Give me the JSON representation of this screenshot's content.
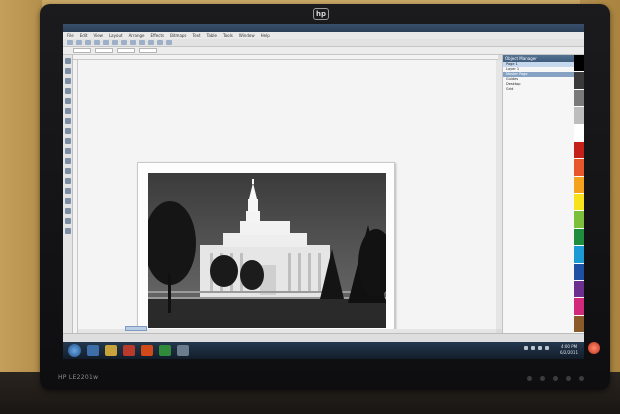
{
  "monitor": {
    "brand_logo": "hp",
    "model_label": "HP LE2201w"
  },
  "app": {
    "title": "",
    "menu": [
      "File",
      "Edit",
      "View",
      "Layout",
      "Arrange",
      "Effects",
      "Bitmaps",
      "Text",
      "Table",
      "Tools",
      "Window",
      "Help"
    ],
    "docker_title": "Object Manager",
    "docker_rows": [
      "Page 1",
      "Layer 1",
      "Master Page",
      "Guides",
      "Desktop",
      "Grid"
    ],
    "status_text": ""
  },
  "taskbar": {
    "clock_time": "4:00 PM",
    "clock_date": "6/2/2011"
  },
  "colors": {
    "wall": "#c9a765",
    "bezel": "#141416",
    "taskbar": "#1b2a3b",
    "docker_header": "#4a6787"
  },
  "palette_colors": [
    "#000000",
    "#3a3a3a",
    "#7a7a7a",
    "#bdbdbd",
    "#ffffff",
    "#c4211b",
    "#e8572b",
    "#f4a21e",
    "#f7e21b",
    "#7bbf3a",
    "#1e8e3e",
    "#1b9ad6",
    "#1d4fa3",
    "#6b2f8f",
    "#d2297a",
    "#8b5a2b"
  ]
}
